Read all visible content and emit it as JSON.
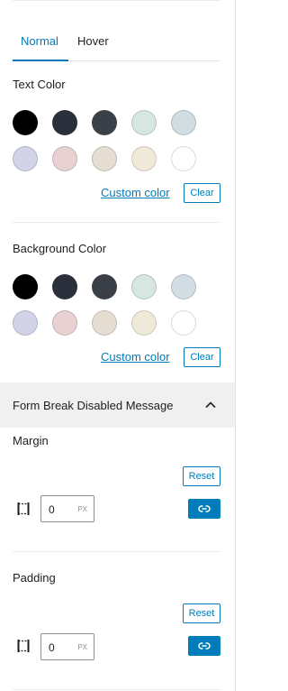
{
  "tabs": [
    {
      "label": "Normal",
      "active": true
    },
    {
      "label": "Hover",
      "active": false
    }
  ],
  "text_color": {
    "label": "Text Color",
    "swatches": [
      "#000000",
      "#2b2f3b",
      "#3a3f48",
      "#d6e7df",
      "#d1dde3",
      "#d2d3e6",
      "#e7d1d3",
      "#e5dcd2",
      "#efe9da",
      "#ffffff"
    ],
    "custom_label": "Custom color",
    "clear_label": "Clear"
  },
  "background_color": {
    "label": "Background Color",
    "swatches": [
      "#000000",
      "#2b2f3b",
      "#3a3f48",
      "#d6e7df",
      "#d1dde3",
      "#d2d3e6",
      "#e7d1d3",
      "#e5dcd2",
      "#efe9da",
      "#ffffff"
    ],
    "custom_label": "Custom color",
    "clear_label": "Clear"
  },
  "panel": {
    "title": "Form Break Disabled Message",
    "icon": "chevron-up-icon",
    "expanded": true
  },
  "margin": {
    "label": "Margin",
    "reset_label": "Reset",
    "value": "0",
    "unit": "PX",
    "icon": "box-sides-icon",
    "link_icon": "link-icon"
  },
  "padding": {
    "label": "Padding",
    "reset_label": "Reset",
    "value": "0",
    "unit": "PX",
    "icon": "box-sides-icon",
    "link_icon": "link-icon"
  },
  "colors": {
    "accent": "#007cba",
    "panel_bg": "#f0f0f0"
  }
}
